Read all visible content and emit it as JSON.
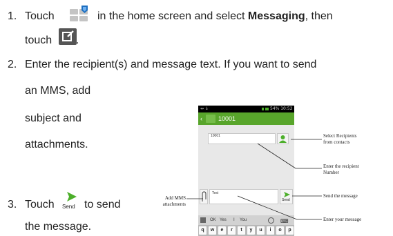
{
  "steps": [
    {
      "num": "1.",
      "line1_pre": "Touch",
      "line1_mid": "in the home screen and select",
      "line1_bold": "Messaging",
      "line1_post": ", then",
      "line2": "touch",
      "line2_end": "."
    },
    {
      "num": "2.",
      "line1": "Enter the recipient(s) and message text. If you want to send",
      "line2": "an MMS, add",
      "line3": "subject and",
      "line4": "attachments."
    },
    {
      "num": "3.",
      "line1_pre": "Touch",
      "line1_post": "to send",
      "line2": "the message."
    }
  ],
  "send_icon_label": "Send",
  "phone": {
    "status_left": "↔ ↓",
    "status_right": "54% 10:52",
    "header_title": "10001",
    "recipient_value": "10001",
    "message_value": "Test",
    "send_label": "Send",
    "suggestions": [
      "OK",
      "Yes",
      "I",
      "You"
    ],
    "keys": [
      {
        "letter": "q",
        "num": "1"
      },
      {
        "letter": "w",
        "num": "2"
      },
      {
        "letter": "e",
        "num": "3"
      },
      {
        "letter": "r",
        "num": "4"
      },
      {
        "letter": "t",
        "num": "5"
      },
      {
        "letter": "y",
        "num": "6"
      },
      {
        "letter": "u",
        "num": "7"
      },
      {
        "letter": "i",
        "num": "8"
      },
      {
        "letter": "o",
        "num": "9"
      },
      {
        "letter": "p",
        "num": "0"
      }
    ]
  },
  "annotations": {
    "select_recipients_1": "Select Recipients",
    "select_recipients_2": "from contacts",
    "enter_number_1": "Enter the recipient",
    "enter_number_2": "Number",
    "send_message": "Send the message",
    "enter_message": "Enter your message",
    "add_mms_1": "Add MMS",
    "add_mms_2": "attachments"
  },
  "colors": {
    "green": "#58a52b",
    "folder_blue": "#1e6fc0",
    "compose_gray": "#555555"
  }
}
